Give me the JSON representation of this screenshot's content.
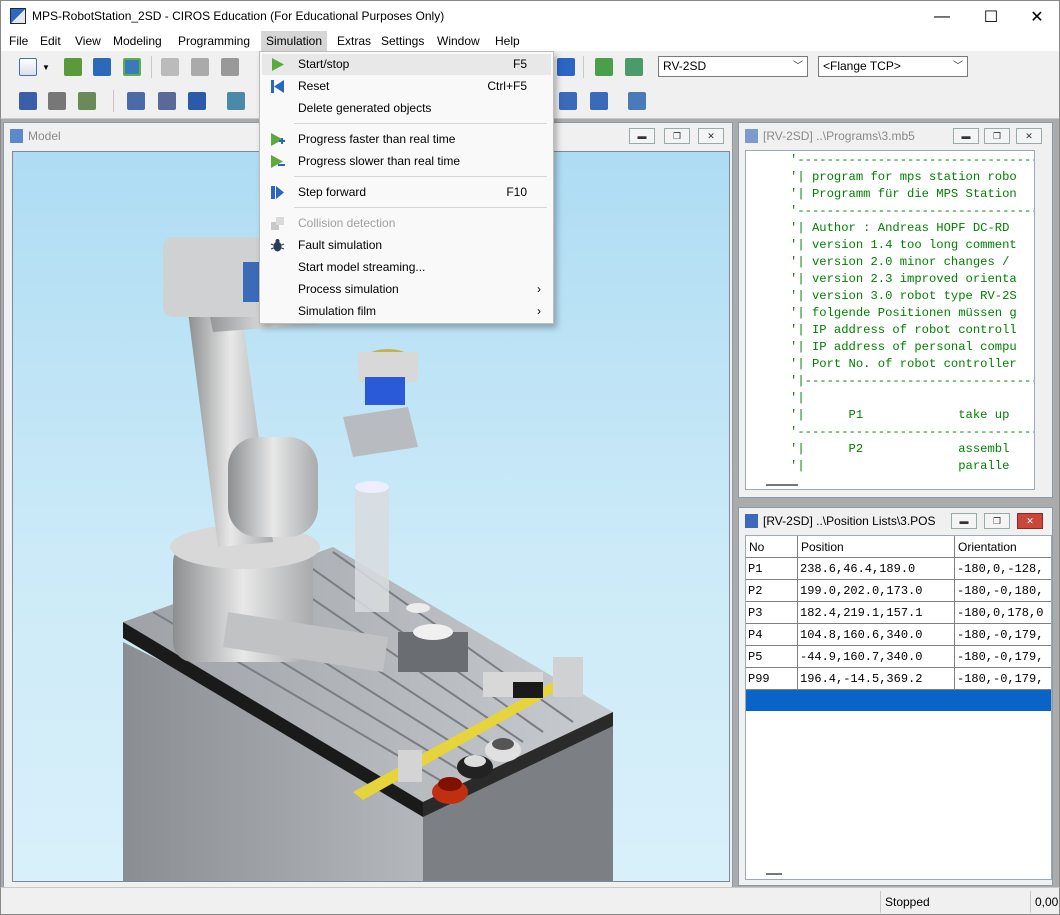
{
  "app": {
    "title": "MPS-RobotStation_2SD - CIROS Education (For Educational Purposes Only)",
    "accent": "#2b66c4"
  },
  "window_controls": {
    "minimize": "—",
    "maximize": "☐",
    "close": "✕"
  },
  "menu": [
    "File",
    "Edit",
    "View",
    "Modeling",
    "Programming",
    "Simulation",
    "Extras",
    "Settings",
    "Window",
    "Help"
  ],
  "toolbar": {
    "robot_select": "RV-2SD",
    "tcp_select": "<Flange TCP>"
  },
  "simulation_menu": {
    "items": [
      {
        "label": "Start/stop",
        "shortcut": "F5",
        "icon": "play-icon"
      },
      {
        "label": "Reset",
        "shortcut": "Ctrl+F5",
        "icon": "reset-icon"
      },
      {
        "label": "Delete generated objects",
        "shortcut": "",
        "icon": ""
      },
      {
        "label": "Progress faster than real time",
        "shortcut": "",
        "icon": "faster-icon"
      },
      {
        "label": "Progress slower than real time",
        "shortcut": "",
        "icon": "slower-icon"
      },
      {
        "label": "Step forward",
        "shortcut": "F10",
        "icon": "step-forward-icon"
      },
      {
        "label": "Collision detection",
        "shortcut": "",
        "icon": "collision-icon",
        "disabled": true
      },
      {
        "label": "Fault simulation",
        "shortcut": "",
        "icon": "bug-icon"
      },
      {
        "label": "Start model streaming...",
        "shortcut": "",
        "icon": ""
      },
      {
        "label": "Process simulation",
        "shortcut": "",
        "icon": "",
        "submenu": true
      },
      {
        "label": "Simulation film",
        "shortcut": "",
        "icon": "",
        "submenu": true
      }
    ],
    "submenu_arrow": "›"
  },
  "model_window": {
    "title": "Model"
  },
  "program_window": {
    "title": "[RV-2SD] ..\\Programs\\3.mb5",
    "lines": [
      "'---------------------------------",
      "'| program for mps station robo",
      "'| Programm für die MPS Station",
      "'---------------------------------",
      "'| Author : Andreas HOPF DC-RD",
      "'| version 1.4 too long comment",
      "'| version 2.0 minor changes /",
      "'| version 2.3 improved orienta",
      "'| version 3.0 robot type RV-2S",
      "'| folgende Positionen müssen g",
      "'| IP address of robot controll",
      "'| IP address of personal compu",
      "'| Port No. of robot controller",
      "'|--------------------------------",
      "'|",
      "'|      P1             take up",
      "'---------------------------------",
      "'|      P2             assembl",
      "'|                     paralle"
    ]
  },
  "position_window": {
    "title": "[RV-2SD] ..\\Position Lists\\3.POS",
    "columns": [
      "No",
      "Position",
      "Orientation"
    ],
    "rows": [
      {
        "no": "P1",
        "position": "238.6,46.4,189.0",
        "orientation": "-180,0,-128,"
      },
      {
        "no": "P2",
        "position": "199.0,202.0,173.0",
        "orientation": "-180,-0,180,"
      },
      {
        "no": "P3",
        "position": "182.4,219.1,157.1",
        "orientation": "-180,0,178,0"
      },
      {
        "no": "P4",
        "position": "104.8,160.6,340.0",
        "orientation": "-180,-0,179,"
      },
      {
        "no": "P5",
        "position": "-44.9,160.7,340.0",
        "orientation": "-180,-0,179,"
      },
      {
        "no": "P99",
        "position": "196.4,-14.5,369.2",
        "orientation": "-180,-0,179,"
      }
    ],
    "selected_color": "#0a64c8"
  },
  "status": {
    "state": "Stopped",
    "value": "0,00"
  }
}
